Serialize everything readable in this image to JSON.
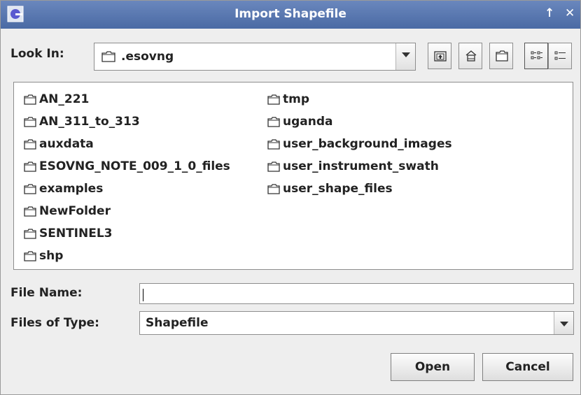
{
  "window": {
    "title": "Import Shapefile",
    "max_glyph": "↑",
    "close_glyph": "✕"
  },
  "look_in": {
    "label": "Look In:",
    "value": ".esovng"
  },
  "toolbar": {
    "icons": [
      "up-folder-icon",
      "home-icon",
      "new-folder-icon",
      "list-view-icon",
      "details-view-icon"
    ]
  },
  "files": {
    "col1": [
      "AN_221",
      "AN_311_to_313",
      "auxdata",
      "ESOVNG_NOTE_009_1_0_files",
      "examples",
      "NewFolder",
      "SENTINEL3",
      "shp"
    ],
    "col2": [
      "tmp",
      "uganda",
      "user_background_images",
      "user_instrument_swath",
      "user_shape_files"
    ]
  },
  "file_name": {
    "label": "File Name:",
    "value": ""
  },
  "file_type": {
    "label": "Files of Type:",
    "value": "Shapefile"
  },
  "buttons": {
    "open": "Open",
    "cancel": "Cancel"
  }
}
